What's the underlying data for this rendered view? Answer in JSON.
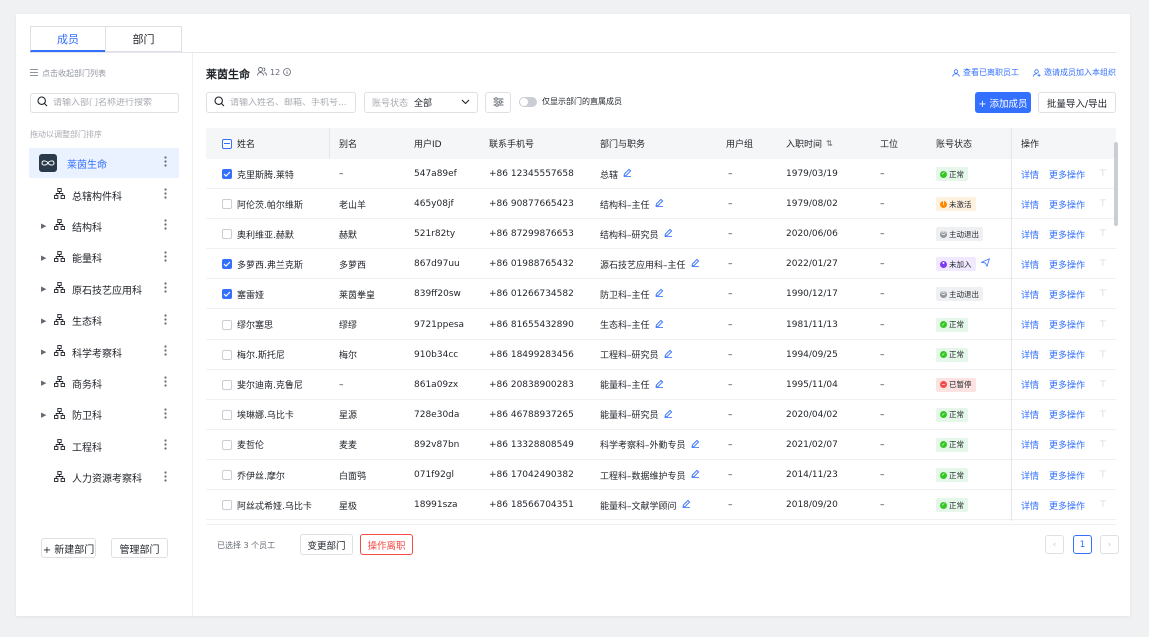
{
  "tabs": [
    {
      "label": "成员",
      "active": true
    },
    {
      "label": "部门",
      "active": false
    }
  ],
  "sidebar": {
    "collapse_hint": "点击收起部门列表",
    "search_placeholder": "请输入部门名称进行搜索",
    "drag_hint": "拖动以调整部门排序",
    "tree": [
      {
        "label": "莱茵生命",
        "type": "root",
        "active": true,
        "expandable": false
      },
      {
        "label": "总辖构件科",
        "type": "child",
        "expandable": false
      },
      {
        "label": "结构科",
        "type": "child",
        "expandable": true
      },
      {
        "label": "能量科",
        "type": "child",
        "expandable": true
      },
      {
        "label": "原石技艺应用科",
        "type": "child",
        "expandable": true
      },
      {
        "label": "生态科",
        "type": "child",
        "expandable": true
      },
      {
        "label": "科学考察科",
        "type": "child",
        "expandable": true
      },
      {
        "label": "商务科",
        "type": "child",
        "expandable": true
      },
      {
        "label": "防卫科",
        "type": "child",
        "expandable": true
      },
      {
        "label": "工程科",
        "type": "child",
        "expandable": false
      },
      {
        "label": "人力资源考察科",
        "type": "child",
        "expandable": false
      }
    ],
    "new_dept_label": "+ 新建部门",
    "manage_dept_label": "管理部门"
  },
  "header": {
    "org_name": "莱茵生命",
    "member_count": "12",
    "link_departed": "查看已离职员工",
    "link_invite": "邀请成员加入本组织"
  },
  "toolbar": {
    "search_placeholder": "请输入姓名、邮箱、手机号...",
    "status_label": "账号状态",
    "status_value": "全部",
    "toggle_label": "仅显示部门的直属成员",
    "add_member_label": "+ 添加成员",
    "batch_label": "批量导入/导出"
  },
  "columns": [
    "姓名",
    "别名",
    "用户ID",
    "联系手机号",
    "部门与职务",
    "用户组",
    "入职时间",
    "工位",
    "账号状态",
    "操作"
  ],
  "sort_icon": "⇅",
  "status_styles": {
    "正常": {
      "bg": "#e4f7e9",
      "fg": "#1f2329",
      "dot": "#34c724",
      "glyph": "✓"
    },
    "未激活": {
      "bg": "#fff1e0",
      "fg": "#1f2329",
      "dot": "#ff8800",
      "glyph": "!"
    },
    "主动退出": {
      "bg": "#eff0f1",
      "fg": "#1f2329",
      "dot": "#8f959e",
      "glyph": "⏻"
    },
    "未加入": {
      "bg": "#f1e9ff",
      "fg": "#1f2329",
      "dot": "#7f3bf5",
      "glyph": "•"
    },
    "已暂停": {
      "bg": "#fde2e2",
      "fg": "#1f2329",
      "dot": "#f54a45",
      "glyph": "−"
    }
  },
  "rows": [
    {
      "checked": true,
      "name": "克里斯腾.莱特",
      "alias": "–",
      "uid": "547a89ef",
      "phone": "+86 12345557658",
      "dept": "总辖",
      "group": "–",
      "date": "1979/03/19",
      "seat": "–",
      "status": "正常",
      "send": false
    },
    {
      "checked": false,
      "name": "阿伦茨.帕尔维斯",
      "alias": "老山羊",
      "uid": "465y08jf",
      "phone": "+86 90877665423",
      "dept": "结构科–主任",
      "group": "–",
      "date": "1979/08/02",
      "seat": "–",
      "status": "未激活",
      "send": false
    },
    {
      "checked": false,
      "name": "奥利维亚.赫默",
      "alias": "赫默",
      "uid": "521r82ty",
      "phone": "+86 87299876653",
      "dept": "结构科–研究员",
      "group": "–",
      "date": "2020/06/06",
      "seat": "–",
      "status": "主动退出",
      "send": false
    },
    {
      "checked": true,
      "name": "多萝西.弗兰克斯",
      "alias": "多萝西",
      "uid": "867d97uu",
      "phone": "+86 01988765432",
      "dept": "源石技艺应用科–主任",
      "group": "–",
      "date": "2022/01/27",
      "seat": "–",
      "status": "未加入",
      "send": true
    },
    {
      "checked": true,
      "name": "塞雷娅",
      "alias": "莱茵拳皇",
      "uid": "839ff20sw",
      "phone": "+86 01266734582",
      "dept": "防卫科–主任",
      "group": "–",
      "date": "1990/12/17",
      "seat": "–",
      "status": "主动退出",
      "send": false
    },
    {
      "checked": false,
      "name": "缪尔塞思",
      "alias": "缪缪",
      "uid": "9721ppesa",
      "phone": "+86 81655432890",
      "dept": "生态科–主任",
      "group": "–",
      "date": "1981/11/13",
      "seat": "–",
      "status": "正常",
      "send": false
    },
    {
      "checked": false,
      "name": "梅尔.斯托尼",
      "alias": "梅尔",
      "uid": "910b34cc",
      "phone": "+86 18499283456",
      "dept": "工程科–研究员",
      "group": "–",
      "date": "1994/09/25",
      "seat": "–",
      "status": "正常",
      "send": false
    },
    {
      "checked": false,
      "name": "斐尔迪南.克鲁尼",
      "alias": "–",
      "uid": "861a09zx",
      "phone": "+86 20838900283",
      "dept": "能量科–主任",
      "group": "–",
      "date": "1995/11/04",
      "seat": "–",
      "status": "已暂停",
      "send": false
    },
    {
      "checked": false,
      "name": "埃琳娜.乌比卡",
      "alias": "星源",
      "uid": "728e30da",
      "phone": "+86 46788937265",
      "dept": "能量科–研究员",
      "group": "–",
      "date": "2020/04/02",
      "seat": "–",
      "status": "正常",
      "send": false
    },
    {
      "checked": false,
      "name": "麦哲伦",
      "alias": "麦麦",
      "uid": "892v87bn",
      "phone": "+86 13328808549",
      "dept": "科学考察科–外勤专员",
      "group": "–",
      "date": "2021/02/07",
      "seat": "–",
      "status": "正常",
      "send": false
    },
    {
      "checked": false,
      "name": "乔伊丝.摩尔",
      "alias": "白面鸮",
      "uid": "071f92gl",
      "phone": "+86 17042490382",
      "dept": "工程科–数据维护专员",
      "group": "–",
      "date": "2014/11/23",
      "seat": "–",
      "status": "正常",
      "send": false
    },
    {
      "checked": false,
      "name": "阿丝忒希娅.乌比卡",
      "alias": "星极",
      "uid": "18991sza",
      "phone": "+86 18566704351",
      "dept": "能量科–文献学顾问",
      "group": "–",
      "date": "2018/09/20",
      "seat": "–",
      "status": "正常",
      "send": false
    }
  ],
  "row_ops": {
    "detail": "详情",
    "more": "更多操作",
    "pin": "⊤"
  },
  "footer": {
    "selected_text": "已选择 3 个员工",
    "change_dept_label": "变更部门",
    "resign_label": "操作离职",
    "page_prev": "‹",
    "page_current": "1",
    "page_next": "›"
  },
  "colors": {
    "accent": "#3370ff",
    "danger": "#f54a45"
  }
}
